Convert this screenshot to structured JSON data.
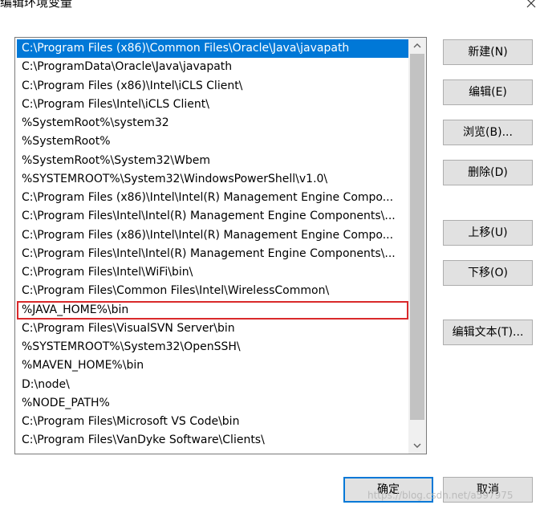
{
  "window": {
    "title": "编辑环境变量",
    "close_icon": "close-icon"
  },
  "list": {
    "items": [
      "C:\\Program Files (x86)\\Common Files\\Oracle\\Java\\javapath",
      "C:\\ProgramData\\Oracle\\Java\\javapath",
      "C:\\Program Files (x86)\\Intel\\iCLS Client\\",
      "C:\\Program Files\\Intel\\iCLS Client\\",
      "%SystemRoot%\\system32",
      "%SystemRoot%",
      "%SystemRoot%\\System32\\Wbem",
      "%SYSTEMROOT%\\System32\\WindowsPowerShell\\v1.0\\",
      "C:\\Program Files (x86)\\Intel\\Intel(R) Management Engine Compo...",
      "C:\\Program Files\\Intel\\Intel(R) Management Engine Components\\...",
      "C:\\Program Files (x86)\\Intel\\Intel(R) Management Engine Compo...",
      "C:\\Program Files\\Intel\\Intel(R) Management Engine Components\\...",
      "C:\\Program Files\\Intel\\WiFi\\bin\\",
      "C:\\Program Files\\Common Files\\Intel\\WirelessCommon\\",
      "%JAVA_HOME%\\bin",
      "C:\\Program Files\\VisualSVN Server\\bin",
      "%SYSTEMROOT%\\System32\\OpenSSH\\",
      "%MAVEN_HOME%\\bin",
      "D:\\node\\",
      "%NODE_PATH%",
      "C:\\Program Files\\Microsoft VS Code\\bin",
      "C:\\Program Files\\VanDyke Software\\Clients\\"
    ],
    "selected_index": 0,
    "highlighted_index": 14,
    "selection_color": "#0078d7",
    "highlight_color": "#d9292b"
  },
  "buttons": {
    "new": "新建(N)",
    "edit": "编辑(E)",
    "browse": "浏览(B)...",
    "delete": "删除(D)",
    "move_up": "上移(U)",
    "move_down": "下移(O)",
    "edit_text": "编辑文本(T)...",
    "ok": "确定",
    "cancel": "取消"
  },
  "watermark": "https://blog.csdn.net/a597975"
}
